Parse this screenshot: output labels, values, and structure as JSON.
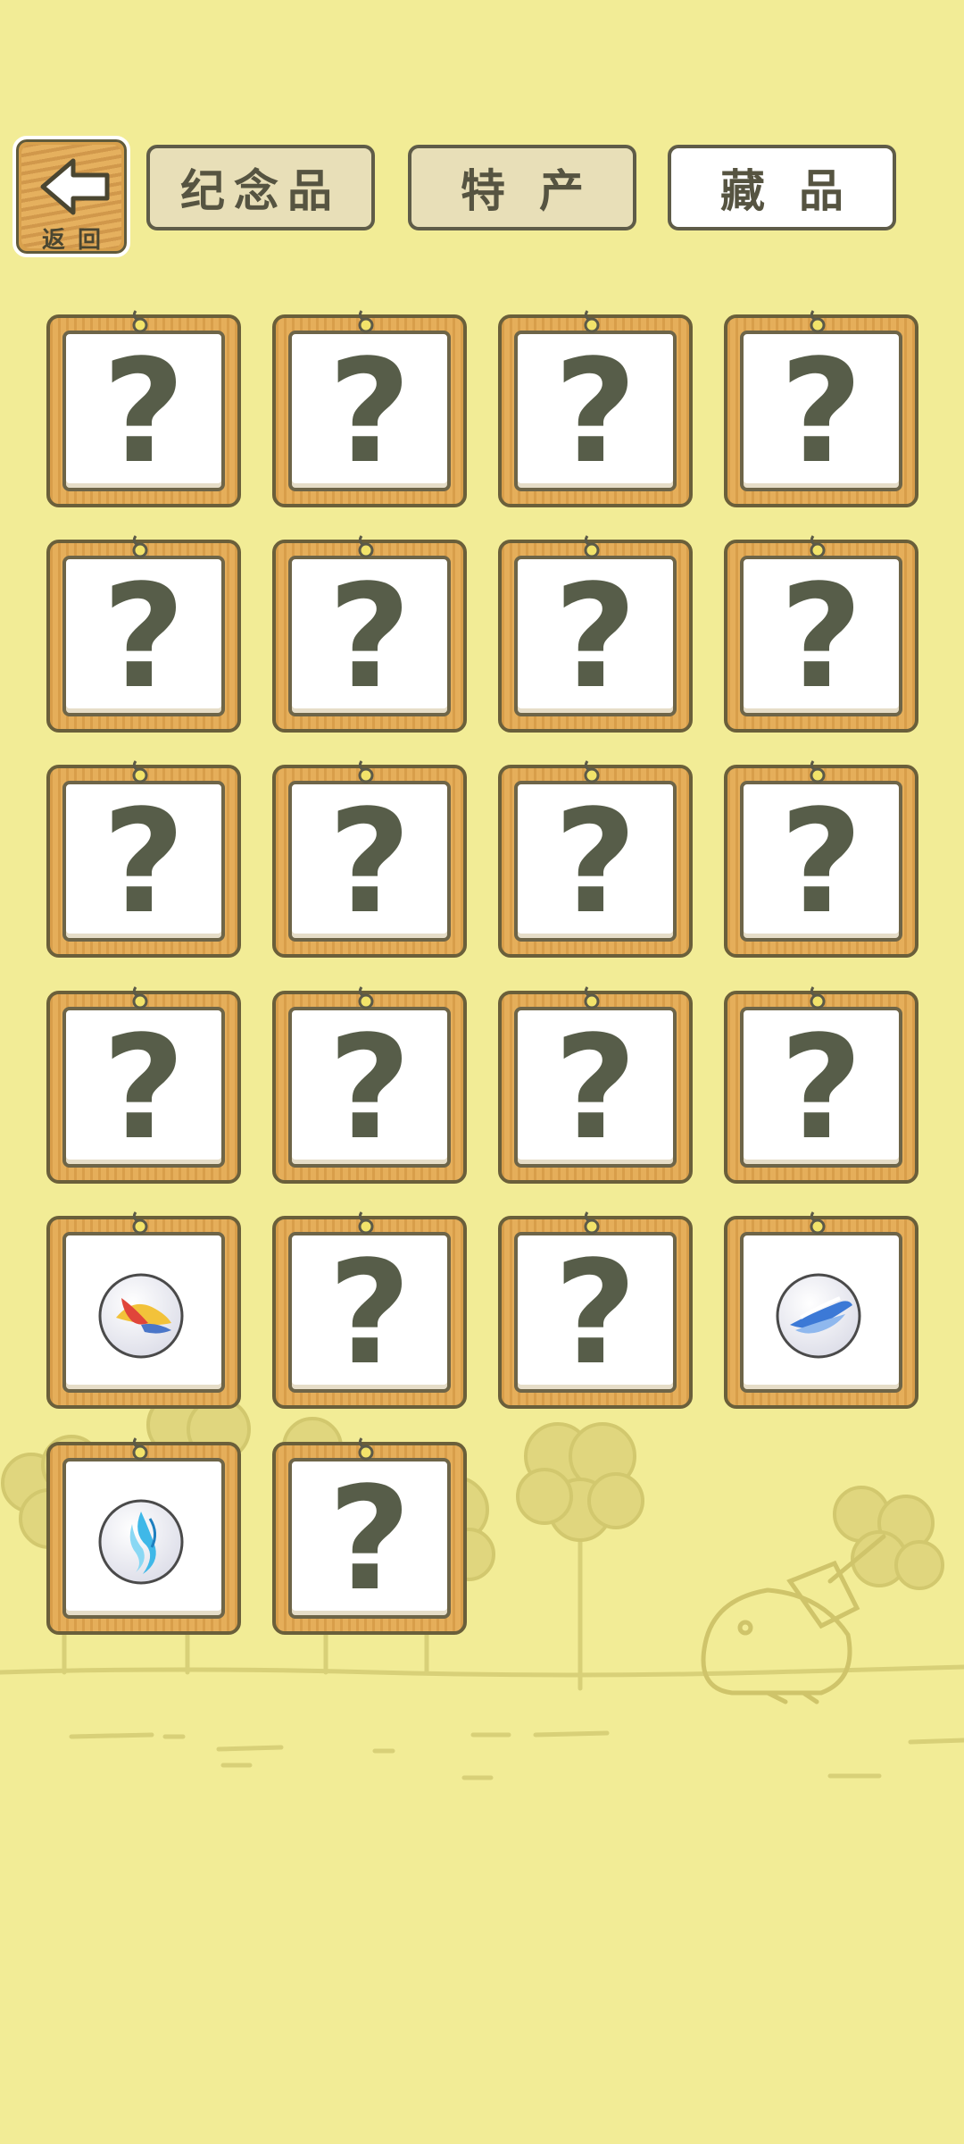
{
  "back_button": {
    "label": "返回",
    "icon": "left-arrow-icon"
  },
  "tabs": [
    {
      "label": "纪念品",
      "active": false
    },
    {
      "label": "特产",
      "active": false
    },
    {
      "label": "藏品",
      "active": true
    }
  ],
  "collection": {
    "items": [
      {
        "state": "unknown",
        "glyph": "?"
      },
      {
        "state": "unknown",
        "glyph": "?"
      },
      {
        "state": "unknown",
        "glyph": "?"
      },
      {
        "state": "unknown",
        "glyph": "?"
      },
      {
        "state": "unknown",
        "glyph": "?"
      },
      {
        "state": "unknown",
        "glyph": "?"
      },
      {
        "state": "unknown",
        "glyph": "?"
      },
      {
        "state": "unknown",
        "glyph": "?"
      },
      {
        "state": "unknown",
        "glyph": "?"
      },
      {
        "state": "unknown",
        "glyph": "?"
      },
      {
        "state": "unknown",
        "glyph": "?"
      },
      {
        "state": "unknown",
        "glyph": "?"
      },
      {
        "state": "unknown",
        "glyph": "?"
      },
      {
        "state": "unknown",
        "glyph": "?"
      },
      {
        "state": "unknown",
        "glyph": "?"
      },
      {
        "state": "unknown",
        "glyph": "?"
      },
      {
        "state": "collected",
        "icon": "red-yellow-marble-icon"
      },
      {
        "state": "unknown",
        "glyph": "?"
      },
      {
        "state": "unknown",
        "glyph": "?"
      },
      {
        "state": "collected",
        "icon": "blue-marble-icon"
      },
      {
        "state": "collected",
        "icon": "cyan-marble-icon"
      },
      {
        "state": "unknown",
        "glyph": "?"
      }
    ]
  },
  "colors": {
    "background": "#f2ec96",
    "frame_wood": "#e2a954",
    "question_mark": "#575d49"
  }
}
